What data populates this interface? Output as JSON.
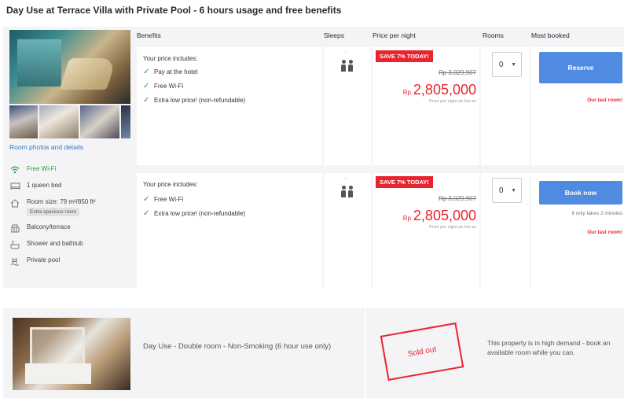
{
  "page": {
    "title": "Day Use at Terrace Villa with Private Pool - 6 hours usage and free benefits"
  },
  "table": {
    "headers": {
      "benefits": "Benefits",
      "sleeps": "Sleeps",
      "price": "Price per night",
      "rooms": "Rooms",
      "most_booked": "Most booked"
    }
  },
  "room": {
    "photo_link": "Room photos and details",
    "facilities": [
      {
        "icon": "wifi-icon",
        "label": "Free Wi-Fi"
      },
      {
        "icon": "bed-icon",
        "label": "1 queen bed"
      },
      {
        "icon": "house-icon",
        "label": "Room size: 79 m²/850 ft²"
      },
      {
        "icon": "balcony-icon",
        "label": "Balcony/terrace"
      },
      {
        "icon": "shower-icon",
        "label": "Shower and bathtub"
      },
      {
        "icon": "pool-icon",
        "label": "Private pool"
      }
    ],
    "size_badge": "Extra spacious room"
  },
  "options": [
    {
      "includes_title": "Your price includes:",
      "benefits": [
        "Pay at the hotel",
        "Free Wi-Fi",
        "Extra low price! (non-refundable)"
      ],
      "save_badge": "SAVE 7% TODAY!",
      "original_price": "Rp 3,029,907",
      "currency": "Rp",
      "price": "2,805,000",
      "price_note": "Price per night as low as",
      "rooms_value": "0",
      "button_label": "Reserve",
      "notes": [
        "Our last room!"
      ]
    },
    {
      "includes_title": "Your price includes:",
      "benefits": [
        "Free Wi-Fi",
        "Extra low price! (non-refundable)"
      ],
      "save_badge": "SAVE 7% TODAY!",
      "original_price": "Rp 3,029,907",
      "currency": "Rp",
      "price": "2,805,000",
      "price_note": "Price per night as low as",
      "rooms_value": "0",
      "button_label": "Book now",
      "notes": [
        "It only takes 2 minutes",
        "Our last room!"
      ]
    }
  ],
  "sold_out": {
    "room_name": "Day Use - Double room - Non-Smoking (6 hour use only)",
    "stamp": "Sold out",
    "demand_message": "This property is in high demand - book an available room while you can."
  },
  "colors": {
    "accent_blue": "#4f8be0",
    "save_red": "#e8252e",
    "check_green": "#2c9a3a",
    "card_bg": "#f4f4f6"
  }
}
